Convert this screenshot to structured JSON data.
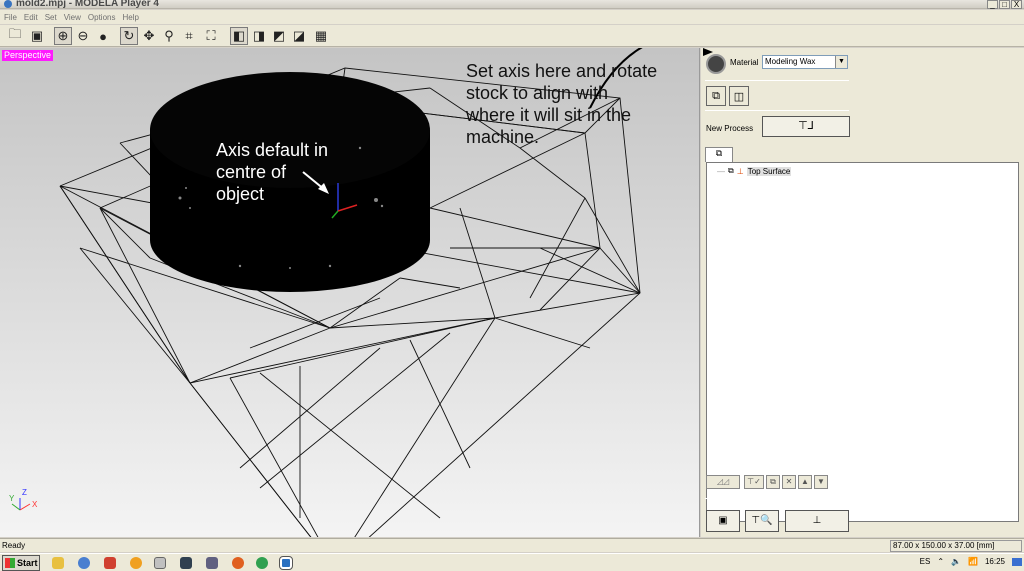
{
  "window": {
    "title": "mold2.mpj - MODELA Player 4",
    "controls": [
      "_",
      "□",
      "X"
    ]
  },
  "menu": [
    "File",
    "Edit",
    "Set",
    "View",
    "Options",
    "Help"
  ],
  "toolbar": {
    "buttons": [
      {
        "name": "open-folder-icon",
        "glyph": "🗀"
      },
      {
        "name": "save-icon",
        "glyph": "💾"
      },
      {
        "name": "view-wire-sphere-icon",
        "glyph": "⊕"
      },
      {
        "name": "view-hollow-sphere-icon",
        "glyph": "⊖"
      },
      {
        "name": "view-solid-sphere-icon",
        "glyph": "●"
      },
      {
        "name": "rotate-icon",
        "glyph": "⟲"
      },
      {
        "name": "pan-icon",
        "glyph": "✥"
      },
      {
        "name": "zoom-icon",
        "glyph": "🔍"
      },
      {
        "name": "fit-icon",
        "glyph": "⌗"
      },
      {
        "name": "zoom-window-icon",
        "glyph": "⌗"
      },
      {
        "name": "view-iso-icon",
        "glyph": "◼"
      },
      {
        "name": "view-front-icon",
        "glyph": "◼"
      },
      {
        "name": "view-side-icon",
        "glyph": "◼"
      },
      {
        "name": "view-back-icon",
        "glyph": "◼"
      },
      {
        "name": "view-multi-icon",
        "glyph": "▦"
      }
    ]
  },
  "viewport": {
    "mode": "Perspective",
    "annotation_axis": "Axis default in\ncentre of\nobject",
    "annotation_stock": "Set axis here and rotate\nstock to align with\nwhere it will sit in the\nmachine.",
    "axis_labels": {
      "z": "Z",
      "x": "X",
      "y": "Y"
    }
  },
  "panel": {
    "material_label": "Material",
    "material_value": "Modeling Wax",
    "new_process_label": "New Process",
    "tree_items": [
      {
        "label": "Top Surface"
      }
    ]
  },
  "status": {
    "text": "Ready",
    "dims": "87.00 x 150.00 x 37.00 [mm]"
  },
  "taskbar": {
    "start": "Start",
    "lang": "ES",
    "time": "16:25"
  }
}
